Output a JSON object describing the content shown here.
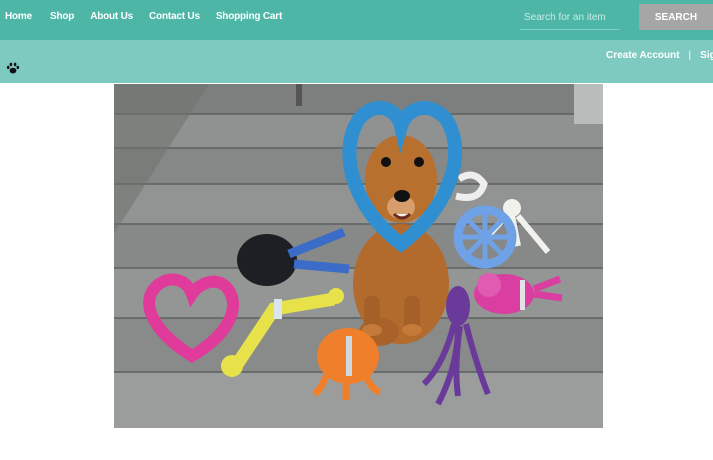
{
  "nav": {
    "items": [
      {
        "label": "Home"
      },
      {
        "label": "Shop"
      },
      {
        "label": "About Us"
      },
      {
        "label": "Contact Us"
      },
      {
        "label": "Shopping Cart"
      }
    ]
  },
  "search": {
    "placeholder": "Search for an item",
    "button_label": "SEARCH"
  },
  "account": {
    "create_label": "Create Account",
    "separator": "|",
    "signin_label": "Sign in"
  },
  "icons": {
    "logo": "paw-icon"
  },
  "colors": {
    "topbar": "#4db6a6",
    "subbar": "#7ecac1",
    "search_button": "#a6a6a6"
  }
}
